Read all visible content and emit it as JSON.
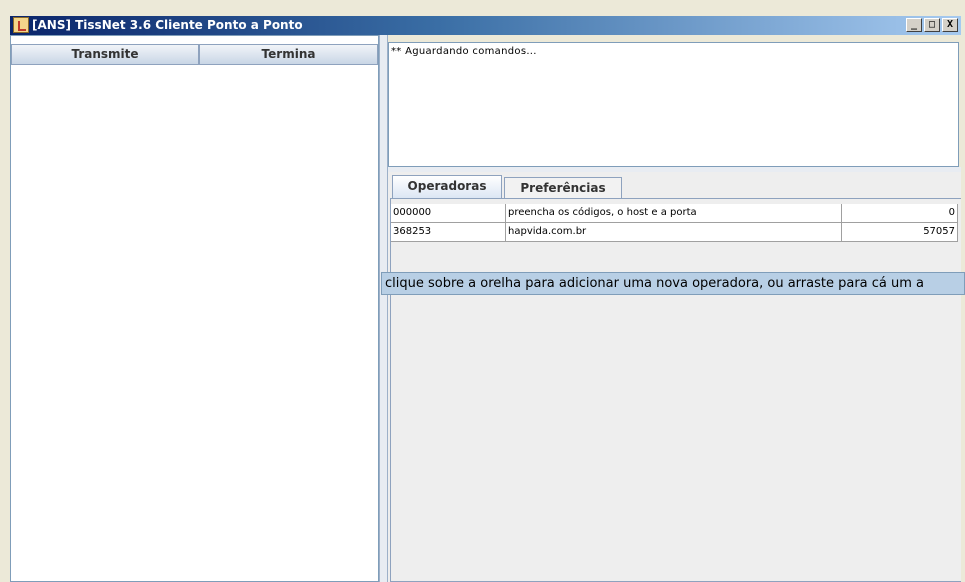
{
  "window": {
    "title": "[ANS] TissNet 3.6 Cliente Ponto a Ponto",
    "icon": "java-cup-icon",
    "controls": {
      "minimize": "_",
      "maximize": "□",
      "close": "X"
    }
  },
  "transfers": {
    "columns": [
      "Transmite",
      "Termina"
    ]
  },
  "log": {
    "text": "** Aguardando comandos..."
  },
  "tabs": [
    {
      "label": "Operadoras",
      "active": true
    },
    {
      "label": "Preferências",
      "active": false
    }
  ],
  "operadoras": {
    "rows": [
      {
        "code": "000000",
        "host": "preencha os códigos, o host e a porta",
        "port": "0"
      },
      {
        "code": "368253",
        "host": "hapvida.com.br",
        "port": "57057"
      }
    ]
  },
  "tooltip": {
    "text": "clique sobre a orelha para adicionar uma nova operadora, ou arraste para cá um a"
  }
}
